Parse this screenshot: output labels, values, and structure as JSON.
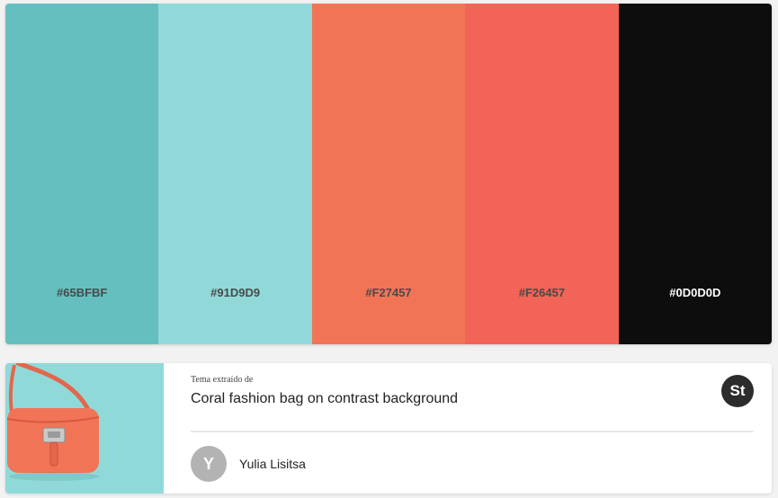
{
  "palette": {
    "swatches": [
      {
        "hex_label": "#65BFBF",
        "color": "#65BFBF"
      },
      {
        "hex_label": "#91D9D9",
        "color": "#91D9D9"
      },
      {
        "hex_label": "#F27457",
        "color": "#F27457"
      },
      {
        "hex_label": "#F26457",
        "color": "#F26457"
      },
      {
        "hex_label": "#0D0D0D",
        "color": "#0D0D0D"
      }
    ]
  },
  "theme_card": {
    "kicker": "Tema extraído de",
    "title": "Coral fashion bag on contrast background",
    "source_badge": "St",
    "author": {
      "initial": "Y",
      "name": "Yulia Lisitsa"
    },
    "thumbnail": {
      "subject": "coral handbag on turquoise background",
      "background_color": "#8fdad9",
      "bag_color": "#F27457"
    }
  }
}
